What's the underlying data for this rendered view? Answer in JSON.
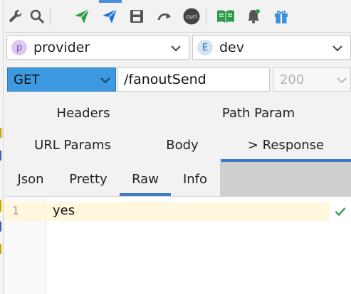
{
  "toolbar": {
    "icons": [
      "wrench-icon",
      "search-icon",
      "send-icon",
      "send-icon",
      "save-icon",
      "redo-icon",
      "curl-icon",
      "book-icon",
      "bell-icon",
      "gift-icon"
    ],
    "curl_label": "curl",
    "colors": {
      "green": "#2e9a4c",
      "blue": "#1e78d8",
      "gray": "#555555"
    }
  },
  "selectors": {
    "module": {
      "badge": "p",
      "label": "provider",
      "badge_color": "#dcc8f0",
      "badge_text_color": "#7a4db0"
    },
    "env": {
      "badge": "E",
      "label": "dev",
      "badge_color": "#cfe4f5",
      "badge_text_color": "#2c6ea8"
    }
  },
  "request": {
    "method": "GET",
    "url": "/fanoutSend",
    "status": "200"
  },
  "tabs": {
    "row1": [
      "Headers",
      "Path Param"
    ],
    "row2": [
      "URL Params",
      "Body",
      "> Response"
    ],
    "active": "> Response"
  },
  "subtabs": {
    "items": [
      "Json",
      "Pretty",
      "Raw",
      "Info"
    ],
    "active": "Raw"
  },
  "editor": {
    "line_number": "1",
    "text": "yes",
    "status_icon": "check-icon"
  }
}
